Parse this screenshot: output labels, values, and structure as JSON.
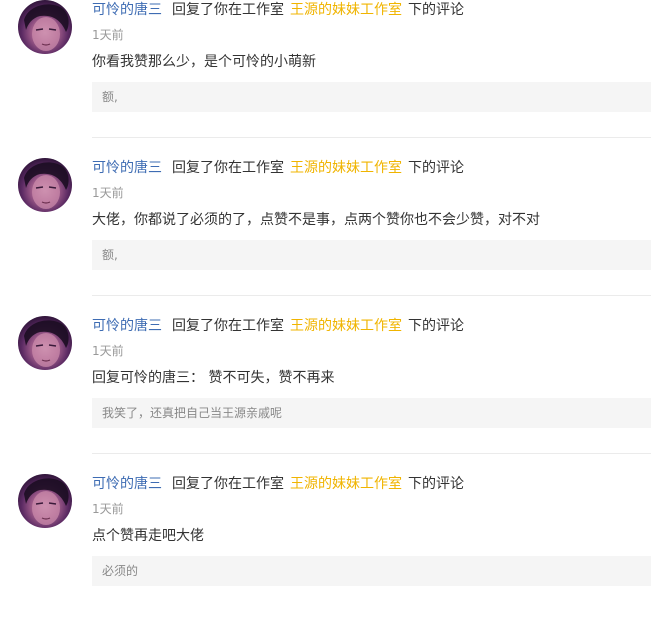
{
  "notifications": [
    {
      "user": "可怜的唐三",
      "action": "回复了你在工作室",
      "studio": "王源的妹妹工作室",
      "suffix": "下的评论",
      "time": "1天前",
      "content": "你看我赞那么少，是个可怜的小萌新",
      "quote": "额,"
    },
    {
      "user": "可怜的唐三",
      "action": "回复了你在工作室",
      "studio": "王源的妹妹工作室",
      "suffix": "下的评论",
      "time": "1天前",
      "content": "大佬，你都说了必须的了，点赞不是事，点两个赞你也不会少赞，对不对",
      "quote": "额,"
    },
    {
      "user": "可怜的唐三",
      "action": "回复了你在工作室",
      "studio": "王源的妹妹工作室",
      "suffix": "下的评论",
      "time": "1天前",
      "content": "回复可怜的唐三：  赞不可失，赞不再来",
      "quote": "我笑了，还真把自己当王源亲戚呢"
    },
    {
      "user": "可怜的唐三",
      "action": "回复了你在工作室",
      "studio": "王源的妹妹工作室",
      "suffix": "下的评论",
      "time": "1天前",
      "content": "点个赞再走吧大佬",
      "quote": "必须的"
    }
  ],
  "colors": {
    "user_link": "#3e6cb3",
    "studio_link": "#f0b400",
    "text": "#333333",
    "time": "#999999",
    "quote_bg": "#f5f5f5",
    "quote_text": "#888888",
    "divider": "#ebebeb"
  }
}
